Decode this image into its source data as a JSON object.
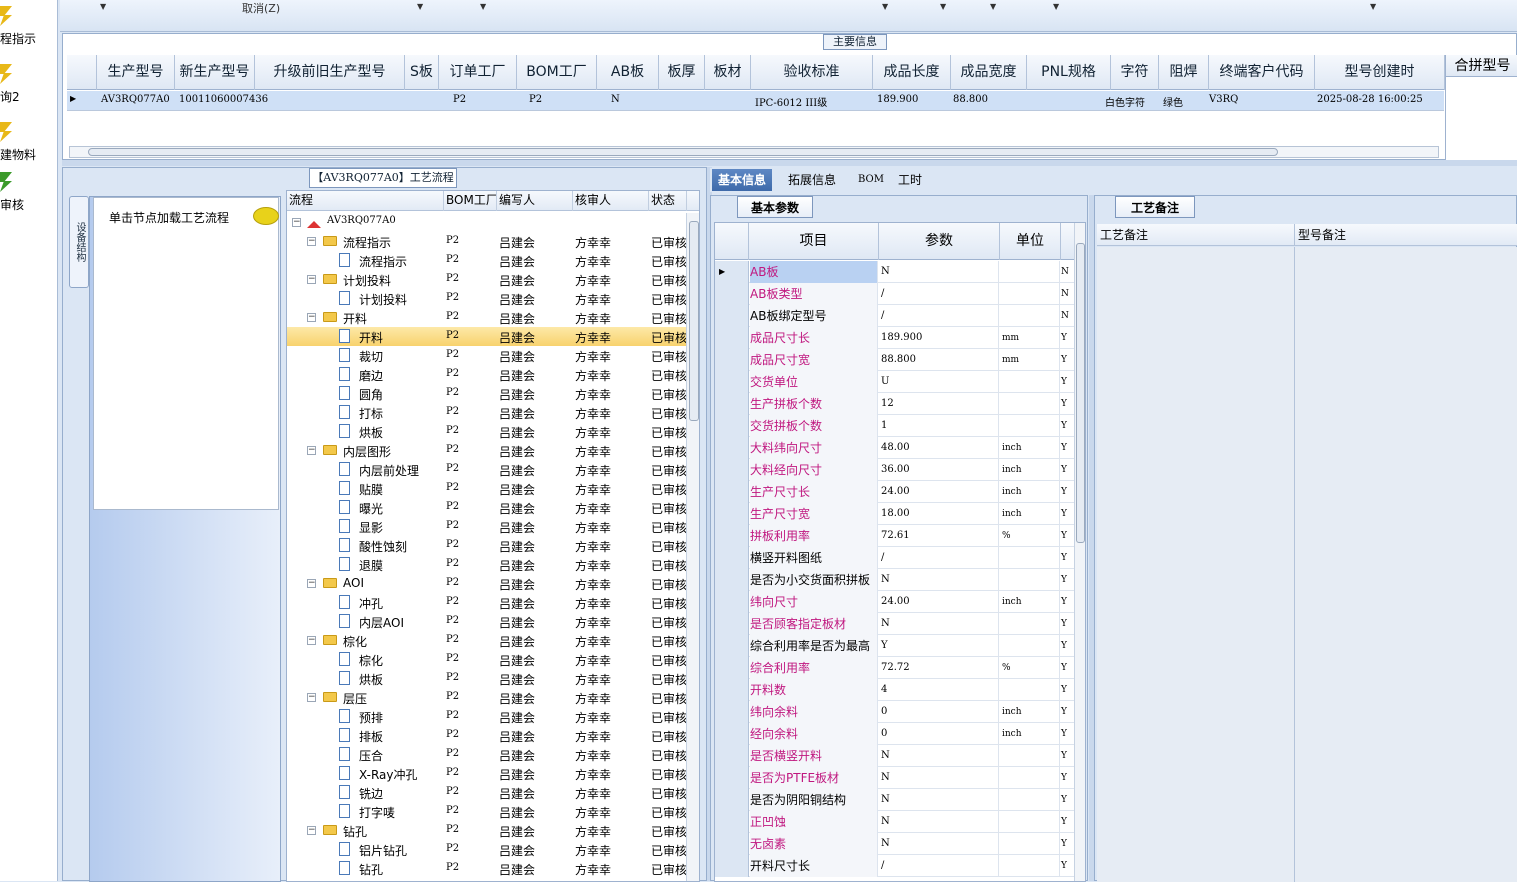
{
  "left_nav": {
    "items": [
      {
        "label": "程指示",
        "icon": "lightning-icon",
        "icon_color": "#e8b818"
      },
      {
        "label": "询2",
        "icon": "lightning-icon",
        "icon_color": "#e8b818"
      },
      {
        "label": "建物料",
        "icon": "lightning-icon",
        "icon_color": "#e8b818"
      },
      {
        "label": "审核",
        "icon": "user-icon",
        "icon_color": "#3b9a2a"
      }
    ]
  },
  "toolbar": {
    "cancel_label": "取消(Z)"
  },
  "main_info": {
    "title": "主要信息",
    "columns": [
      "生产型号",
      "新生产型号",
      "升级前旧生产型号",
      "S板",
      "订单工厂",
      "BOM工厂",
      "AB板",
      "板厚",
      "板材",
      "验收标准",
      "成品长度",
      "成品宽度",
      "PNL规格",
      "字符",
      "阻焊",
      "终端客户代码",
      "型号创建时"
    ],
    "combine_header": "合拼型号",
    "row": {
      "生产型号": "AV3RQ077A0",
      "新生产型号": "10011060007436",
      "订单工厂": "P2",
      "BOM工厂": "P2",
      "AB板": "N",
      "验收标准": "IPC-6012 III级",
      "成品长度": "189.900",
      "成品宽度": "88.800",
      "字符": "白色字符",
      "阻焊": "绿色",
      "终端客户代码": "V3RQ",
      "型号创建时": "2025-08-28 16:00:25"
    }
  },
  "process": {
    "title": "【AV3RQ077A0】工艺流程",
    "vertical_tab": "设备结构",
    "load_text": "单击节点加载工艺流程",
    "columns": [
      "流程",
      "BOM工厂",
      "编写人",
      "核审人",
      "状态"
    ],
    "root": "AV3RQ077A0",
    "rows": [
      {
        "level": 1,
        "type": "folder",
        "name": "流程指示"
      },
      {
        "level": 2,
        "type": "doc",
        "name": "流程指示"
      },
      {
        "level": 1,
        "type": "folder",
        "name": "计划投料"
      },
      {
        "level": 2,
        "type": "doc",
        "name": "计划投料"
      },
      {
        "level": 1,
        "type": "folder",
        "name": "开料"
      },
      {
        "level": 2,
        "type": "doc",
        "name": "开料",
        "selected": true
      },
      {
        "level": 2,
        "type": "doc",
        "name": "裁切"
      },
      {
        "level": 2,
        "type": "doc",
        "name": "磨边"
      },
      {
        "level": 2,
        "type": "doc",
        "name": "圆角"
      },
      {
        "level": 2,
        "type": "doc",
        "name": "打标"
      },
      {
        "level": 2,
        "type": "doc",
        "name": "烘板"
      },
      {
        "level": 1,
        "type": "folder",
        "name": "内层图形"
      },
      {
        "level": 2,
        "type": "doc",
        "name": "内层前处理"
      },
      {
        "level": 2,
        "type": "doc",
        "name": "贴膜"
      },
      {
        "level": 2,
        "type": "doc",
        "name": "曝光"
      },
      {
        "level": 2,
        "type": "doc",
        "name": "显影"
      },
      {
        "level": 2,
        "type": "doc",
        "name": "酸性蚀刻"
      },
      {
        "level": 2,
        "type": "doc",
        "name": "退膜"
      },
      {
        "level": 1,
        "type": "folder",
        "name": "AOI"
      },
      {
        "level": 2,
        "type": "doc",
        "name": "冲孔"
      },
      {
        "level": 2,
        "type": "doc",
        "name": "内层AOI"
      },
      {
        "level": 1,
        "type": "folder",
        "name": "棕化"
      },
      {
        "level": 2,
        "type": "doc",
        "name": "棕化"
      },
      {
        "level": 2,
        "type": "doc",
        "name": "烘板"
      },
      {
        "level": 1,
        "type": "folder",
        "name": "层压"
      },
      {
        "level": 2,
        "type": "doc",
        "name": "预排"
      },
      {
        "level": 2,
        "type": "doc",
        "name": "排板"
      },
      {
        "level": 2,
        "type": "doc",
        "name": "压合"
      },
      {
        "level": 2,
        "type": "doc",
        "name": "X-Ray冲孔"
      },
      {
        "level": 2,
        "type": "doc",
        "name": "铣边"
      },
      {
        "level": 2,
        "type": "doc",
        "name": "打字唛"
      },
      {
        "level": 1,
        "type": "folder",
        "name": "钻孔"
      },
      {
        "level": 2,
        "type": "doc",
        "name": "铝片钻孔"
      },
      {
        "level": 2,
        "type": "doc",
        "name": "钻孔"
      }
    ],
    "row_bom": "P2",
    "row_writer": "吕建会",
    "row_reviewer": "方幸幸",
    "row_status": "已审核"
  },
  "tabs": [
    "基本信息",
    "拓展信息",
    "BOM",
    "工时"
  ],
  "basic": {
    "caption": "基本参数",
    "columns": [
      "项目",
      "参数",
      "单位"
    ],
    "rows": [
      {
        "item": "AB板",
        "param": "N",
        "unit": "",
        "flag": "N",
        "pink": true
      },
      {
        "item": "AB板类型",
        "param": "/",
        "unit": "",
        "flag": "N",
        "pink": true
      },
      {
        "item": "AB板绑定型号",
        "param": "/",
        "unit": "",
        "flag": "N",
        "pink": false
      },
      {
        "item": "成品尺寸长",
        "param": "189.900",
        "unit": "mm",
        "flag": "Y",
        "pink": true
      },
      {
        "item": "成品尺寸宽",
        "param": "88.800",
        "unit": "mm",
        "flag": "Y",
        "pink": true
      },
      {
        "item": "交货单位",
        "param": "U",
        "unit": "",
        "flag": "Y",
        "pink": true
      },
      {
        "item": "生产拼板个数",
        "param": "12",
        "unit": "",
        "flag": "Y",
        "pink": true
      },
      {
        "item": "交货拼板个数",
        "param": "1",
        "unit": "",
        "flag": "Y",
        "pink": true
      },
      {
        "item": "大料纬向尺寸",
        "param": "48.00",
        "unit": "inch",
        "flag": "Y",
        "pink": true
      },
      {
        "item": "大料经向尺寸",
        "param": "36.00",
        "unit": "inch",
        "flag": "Y",
        "pink": true
      },
      {
        "item": "生产尺寸长",
        "param": "24.00",
        "unit": "inch",
        "flag": "Y",
        "pink": true
      },
      {
        "item": "生产尺寸宽",
        "param": "18.00",
        "unit": "inch",
        "flag": "Y",
        "pink": true
      },
      {
        "item": "拼板利用率",
        "param": "72.61",
        "unit": "%",
        "flag": "Y",
        "pink": true
      },
      {
        "item": "横竖开料图纸",
        "param": "/",
        "unit": "",
        "flag": "Y",
        "pink": false
      },
      {
        "item": "是否为小交货面积拼板",
        "param": "N",
        "unit": "",
        "flag": "Y",
        "pink": false
      },
      {
        "item": "纬向尺寸",
        "param": "24.00",
        "unit": "inch",
        "flag": "Y",
        "pink": true
      },
      {
        "item": "是否顾客指定板材",
        "param": "N",
        "unit": "",
        "flag": "Y",
        "pink": true
      },
      {
        "item": "综合利用率是否为最高",
        "param": "Y",
        "unit": "",
        "flag": "Y",
        "pink": false
      },
      {
        "item": "综合利用率",
        "param": "72.72",
        "unit": "%",
        "flag": "Y",
        "pink": true
      },
      {
        "item": "开料数",
        "param": "4",
        "unit": "",
        "flag": "Y",
        "pink": true
      },
      {
        "item": "纬向余料",
        "param": "0",
        "unit": "inch",
        "flag": "Y",
        "pink": true
      },
      {
        "item": "经向余料",
        "param": "0",
        "unit": "inch",
        "flag": "Y",
        "pink": true
      },
      {
        "item": "是否横竖开料",
        "param": "N",
        "unit": "",
        "flag": "Y",
        "pink": true
      },
      {
        "item": "是否为PTFE板材",
        "param": "N",
        "unit": "",
        "flag": "Y",
        "pink": true
      },
      {
        "item": "是否为阴阳铜结构",
        "param": "N",
        "unit": "",
        "flag": "Y",
        "pink": false
      },
      {
        "item": "正凹蚀",
        "param": "N",
        "unit": "",
        "flag": "Y",
        "pink": true
      },
      {
        "item": "无卤素",
        "param": "N",
        "unit": "",
        "flag": "Y",
        "pink": true
      },
      {
        "item": "开料尺寸长",
        "param": "/",
        "unit": "",
        "flag": "Y",
        "pink": false
      }
    ]
  },
  "notes": {
    "caption": "工艺备注",
    "columns": [
      "工艺备注",
      "型号备注"
    ]
  },
  "colors": {
    "pink": "#c0177f",
    "selection": "#cfe0f6",
    "active_tab": "#4a76b6"
  }
}
